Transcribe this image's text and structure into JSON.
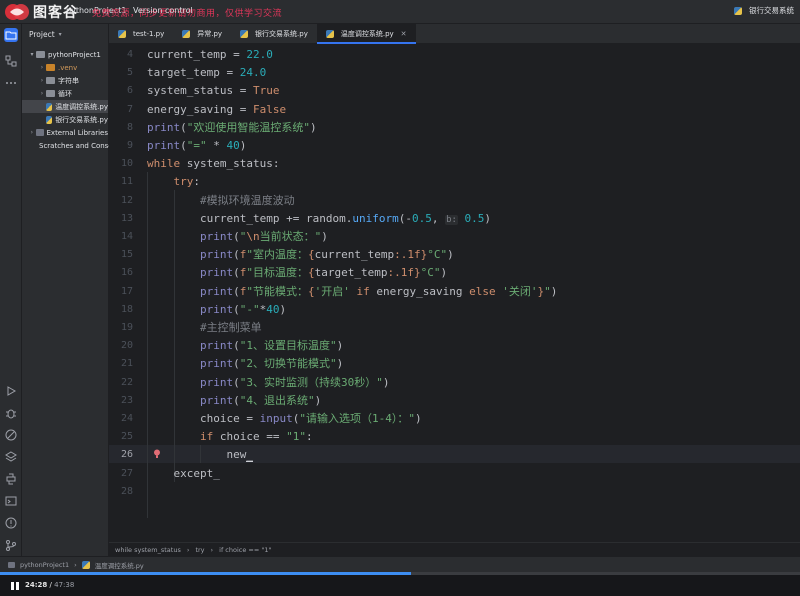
{
  "titlebar": {
    "brand": "图客谷",
    "project_menu": "pythonProject1",
    "vcs_menu": "Version control",
    "watermark": "免费资源，同步更新请勿商用，仅供学习交流",
    "run_config": "银行交易系统"
  },
  "project_panel": {
    "header": "Project",
    "items": [
      {
        "label": "pythonProject1",
        "kind": "folder",
        "expanded": true
      },
      {
        "label": ".venv",
        "kind": "venv"
      },
      {
        "label": "字符串",
        "kind": "folder"
      },
      {
        "label": "循环",
        "kind": "folder"
      },
      {
        "label": "温度调控系统.py",
        "kind": "py",
        "selected": true
      },
      {
        "label": "银行交易系统.py",
        "kind": "py"
      },
      {
        "label": "External Libraries",
        "kind": "lib"
      },
      {
        "label": "Scratches and Consoles",
        "kind": "scratch"
      }
    ]
  },
  "tabs": [
    {
      "label": "test-1.py",
      "active": false
    },
    {
      "label": "异常.py",
      "active": false
    },
    {
      "label": "银行交易系统.py",
      "active": false
    },
    {
      "label": "温度调控系统.py",
      "active": true
    }
  ],
  "editor": {
    "current_line": 26,
    "lines": [
      {
        "n": "4",
        "text": "current_temp = 22.0"
      },
      {
        "n": "5",
        "text": "target_temp = 24.0"
      },
      {
        "n": "6",
        "text": "system_status = True"
      },
      {
        "n": "7",
        "text": "energy_saving = False"
      },
      {
        "n": "8",
        "text": "print(\"欢迎使用智能温控系统\")"
      },
      {
        "n": "9",
        "text": "print(\"=\" * 40)"
      },
      {
        "n": "10",
        "text": "while system_status:"
      },
      {
        "n": "11",
        "text": "    try:"
      },
      {
        "n": "12",
        "text": "        #模拟环境温度波动"
      },
      {
        "n": "13",
        "text": "        current_temp += random.uniform(-0.5, b: 0.5)"
      },
      {
        "n": "14",
        "text": "        print(\"\\n当前状态：\")"
      },
      {
        "n": "15",
        "text": "        print(f\"室内温度：{current_temp:.1f}°C\")"
      },
      {
        "n": "16",
        "text": "        print(f\"目标温度：{target_temp:.1f}°C\")"
      },
      {
        "n": "17",
        "text": "        print(f\"节能模式：{'开启' if energy_saving else '关闭'}\")"
      },
      {
        "n": "18",
        "text": "        print(\"-\"*40)"
      },
      {
        "n": "19",
        "text": "        #主控制菜单"
      },
      {
        "n": "20",
        "text": "        print(\"1、设置目标温度\")"
      },
      {
        "n": "21",
        "text": "        print(\"2、切换节能模式\")"
      },
      {
        "n": "22",
        "text": "        print(\"3、实时监测（持续30秒）\")"
      },
      {
        "n": "23",
        "text": "        print(\"4、退出系统\")"
      },
      {
        "n": "24",
        "text": "        choice = input(\"请输入选项（1-4）：\")"
      },
      {
        "n": "25",
        "text": "        if choice == \"1\":"
      },
      {
        "n": "26",
        "text": "            new_"
      },
      {
        "n": "27",
        "text": "    except_"
      },
      {
        "n": "28",
        "text": ""
      }
    ]
  },
  "breadcrumb": [
    "while system_status",
    "try",
    "if choice == \"1\""
  ],
  "statusbar": {
    "project": "pythonProject1",
    "file": "温度调控系统.py"
  },
  "player": {
    "current_time": "24:28",
    "total_time": "47:38",
    "progress": 0.514
  },
  "colors": {
    "accent": "#3574f0",
    "progress": "#3d8ef2",
    "watermark": "#e0365a"
  }
}
